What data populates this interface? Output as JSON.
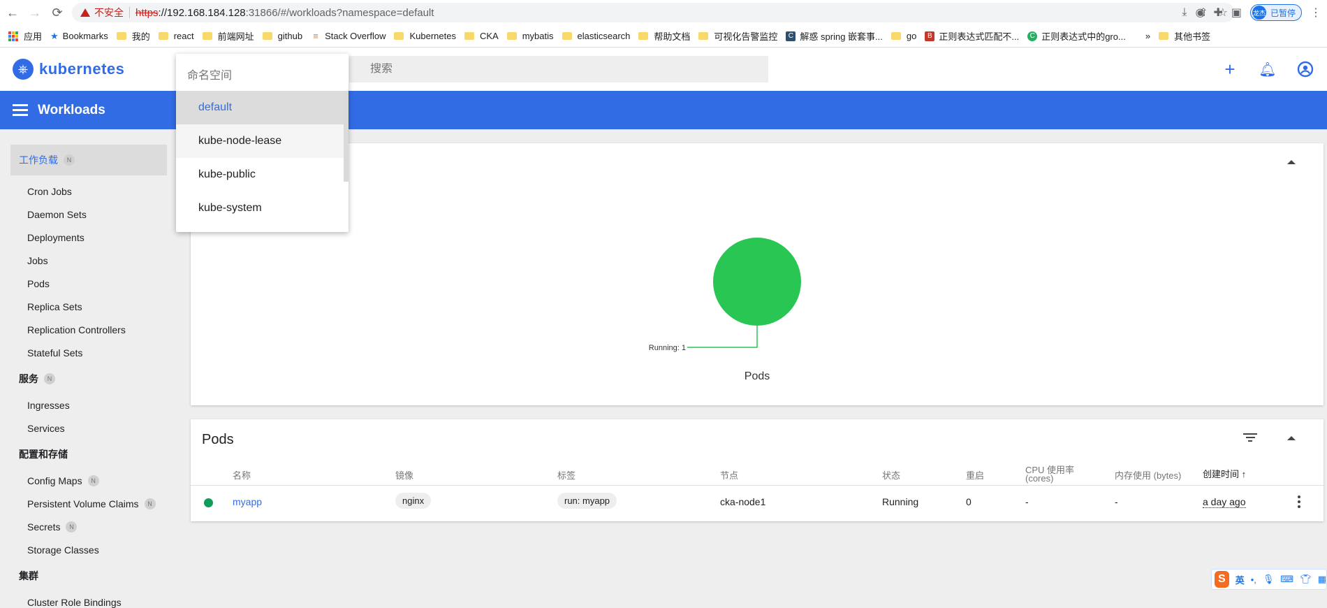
{
  "browser": {
    "security_label": "不安全",
    "url_scheme": "https",
    "url_host": "://192.168.184.128",
    "url_path": ":31866/#/workloads?namespace=default",
    "profile_initials": "龙杰",
    "profile_status": "已暂停"
  },
  "bookmarks": [
    {
      "label": "应用",
      "icon": "apps-icon"
    },
    {
      "label": "Bookmarks",
      "icon": "star-icon"
    },
    {
      "label": "我的",
      "icon": "folder-icon"
    },
    {
      "label": "react",
      "icon": "folder-icon"
    },
    {
      "label": "前端网址",
      "icon": "folder-icon"
    },
    {
      "label": "github",
      "icon": "folder-icon"
    },
    {
      "label": "Stack Overflow",
      "icon": "stackoverflow-icon"
    },
    {
      "label": "Kubernetes",
      "icon": "folder-icon"
    },
    {
      "label": "CKA",
      "icon": "folder-icon"
    },
    {
      "label": "mybatis",
      "icon": "folder-icon"
    },
    {
      "label": "elasticsearch",
      "icon": "folder-icon"
    },
    {
      "label": "帮助文档",
      "icon": "folder-icon"
    },
    {
      "label": "可视化告警监控",
      "icon": "folder-icon"
    },
    {
      "label": "解惑 spring 嵌套事...",
      "icon": "site-icon"
    },
    {
      "label": "go",
      "icon": "folder-icon"
    },
    {
      "label": "正则表达式匹配不...",
      "icon": "site-icon"
    },
    {
      "label": "正则表达式中的gro...",
      "icon": "site-icon"
    }
  ],
  "bookmarks_overflow": "»",
  "bookmarks_other": "其他书签",
  "header": {
    "logo_text": "kubernetes",
    "search_placeholder": "搜索"
  },
  "title_bar": {
    "title": "Workloads"
  },
  "sidebar": {
    "sections": [
      {
        "label": "工作负载",
        "badge": "N",
        "active": true,
        "items": [
          "Cron Jobs",
          "Daemon Sets",
          "Deployments",
          "Jobs",
          "Pods",
          "Replica Sets",
          "Replication Controllers",
          "Stateful Sets"
        ]
      },
      {
        "label": "服务",
        "badge": "N",
        "items": [
          "Ingresses",
          "Services"
        ]
      },
      {
        "label": "配置和存储",
        "items": [
          "Config Maps",
          "Persistent Volume Claims",
          "Secrets",
          "Storage Classes"
        ],
        "item_badges": {
          "Config Maps": "N",
          "Persistent Volume Claims": "N",
          "Secrets": "N"
        }
      },
      {
        "label": "集群",
        "items": [
          "Cluster Role Bindings"
        ]
      }
    ]
  },
  "namespace_dropdown": {
    "label": "命名空间",
    "options": [
      "default",
      "kube-node-lease",
      "kube-public",
      "kube-system"
    ],
    "selected": "default",
    "hovered": "kube-node-lease"
  },
  "chart_data": {
    "type": "pie",
    "title": "Pods",
    "slices": [
      {
        "label": "Running",
        "value": 1,
        "color": "#2ac653"
      }
    ],
    "slice_label_text": "Running: 1"
  },
  "pods_table": {
    "title": "Pods",
    "columns": [
      "名称",
      "镜像",
      "标签",
      "节点",
      "状态",
      "重启",
      "CPU 使用率",
      "(cores)",
      "内存使用 (bytes)",
      "创建时间 ↑"
    ],
    "rows": [
      {
        "name": "myapp",
        "image": "nginx",
        "labels": "run: myapp",
        "node": "cka-node1",
        "status": "Running",
        "restarts": "0",
        "cpu": "-",
        "memory": "-",
        "created": "a day ago"
      }
    ]
  },
  "ime": {
    "brand": "S",
    "lang": "英"
  },
  "colors": {
    "brand_blue": "#326ce5",
    "running_green": "#2ac653",
    "status_dot_green": "#0f9d58"
  }
}
